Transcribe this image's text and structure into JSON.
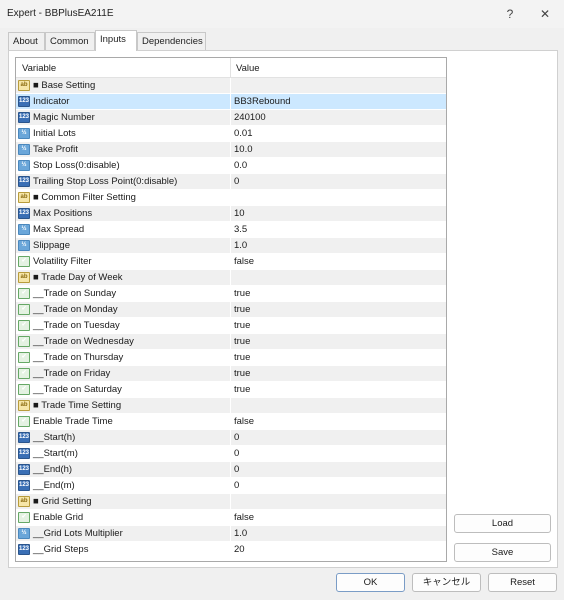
{
  "window": {
    "title": "Expert - BBPlusEA211E",
    "help_glyph": "?",
    "close_glyph": "✕"
  },
  "tabs": [
    "About",
    "Common",
    "Inputs",
    "Dependencies"
  ],
  "active_tab": "Inputs",
  "grid": {
    "col_variable": "Variable",
    "col_value": "Value",
    "rows": [
      {
        "type": "str",
        "label": "■ Base Setting",
        "value": ""
      },
      {
        "type": "int",
        "label": "Indicator",
        "value": "BB3Rebound",
        "selected": true
      },
      {
        "type": "int",
        "label": "Magic Number",
        "value": "240100"
      },
      {
        "type": "dbl",
        "label": "Initial Lots",
        "value": "0.01"
      },
      {
        "type": "dbl",
        "label": "Take Profit",
        "value": "10.0"
      },
      {
        "type": "dbl",
        "label": "Stop Loss(0:disable)",
        "value": "0.0"
      },
      {
        "type": "int",
        "label": "Trailing Stop Loss Point(0:disable)",
        "value": "0"
      },
      {
        "type": "str",
        "label": "■ Common Filter Setting",
        "value": ""
      },
      {
        "type": "int",
        "label": "Max Positions",
        "value": "10"
      },
      {
        "type": "dbl",
        "label": "Max Spread",
        "value": "3.5"
      },
      {
        "type": "dbl",
        "label": "Slippage",
        "value": "1.0"
      },
      {
        "type": "bool",
        "label": "Volatility Filter",
        "value": "false"
      },
      {
        "type": "str",
        "label": "■ Trade Day of Week",
        "value": ""
      },
      {
        "type": "bool",
        "label": "__Trade on Sunday",
        "value": "true"
      },
      {
        "type": "bool",
        "label": "__Trade on Monday",
        "value": "true"
      },
      {
        "type": "bool",
        "label": "__Trade on Tuesday",
        "value": "true"
      },
      {
        "type": "bool",
        "label": "__Trade on Wednesday",
        "value": "true"
      },
      {
        "type": "bool",
        "label": "__Trade on Thursday",
        "value": "true"
      },
      {
        "type": "bool",
        "label": "__Trade on Friday",
        "value": "true"
      },
      {
        "type": "bool",
        "label": "__Trade on Saturday",
        "value": "true"
      },
      {
        "type": "str",
        "label": "■ Trade Time Setting",
        "value": ""
      },
      {
        "type": "bool",
        "label": "Enable Trade Time",
        "value": "false"
      },
      {
        "type": "int",
        "label": "__Start(h)",
        "value": "0"
      },
      {
        "type": "int",
        "label": "__Start(m)",
        "value": "0"
      },
      {
        "type": "int",
        "label": "__End(h)",
        "value": "0"
      },
      {
        "type": "int",
        "label": "__End(m)",
        "value": "0"
      },
      {
        "type": "str",
        "label": "■ Grid Setting",
        "value": ""
      },
      {
        "type": "bool",
        "label": "Enable Grid",
        "value": "false"
      },
      {
        "type": "dbl",
        "label": "__Grid Lots Multiplier",
        "value": "1.0"
      },
      {
        "type": "int",
        "label": "__Grid Steps",
        "value": "20"
      }
    ]
  },
  "buttons": {
    "load": "Load",
    "save": "Save",
    "ok": "OK",
    "cancel": "キャンセル",
    "reset": "Reset"
  },
  "icon_text": {
    "int": "123",
    "dbl": "½",
    "bool": "✔",
    "str": "ab"
  }
}
